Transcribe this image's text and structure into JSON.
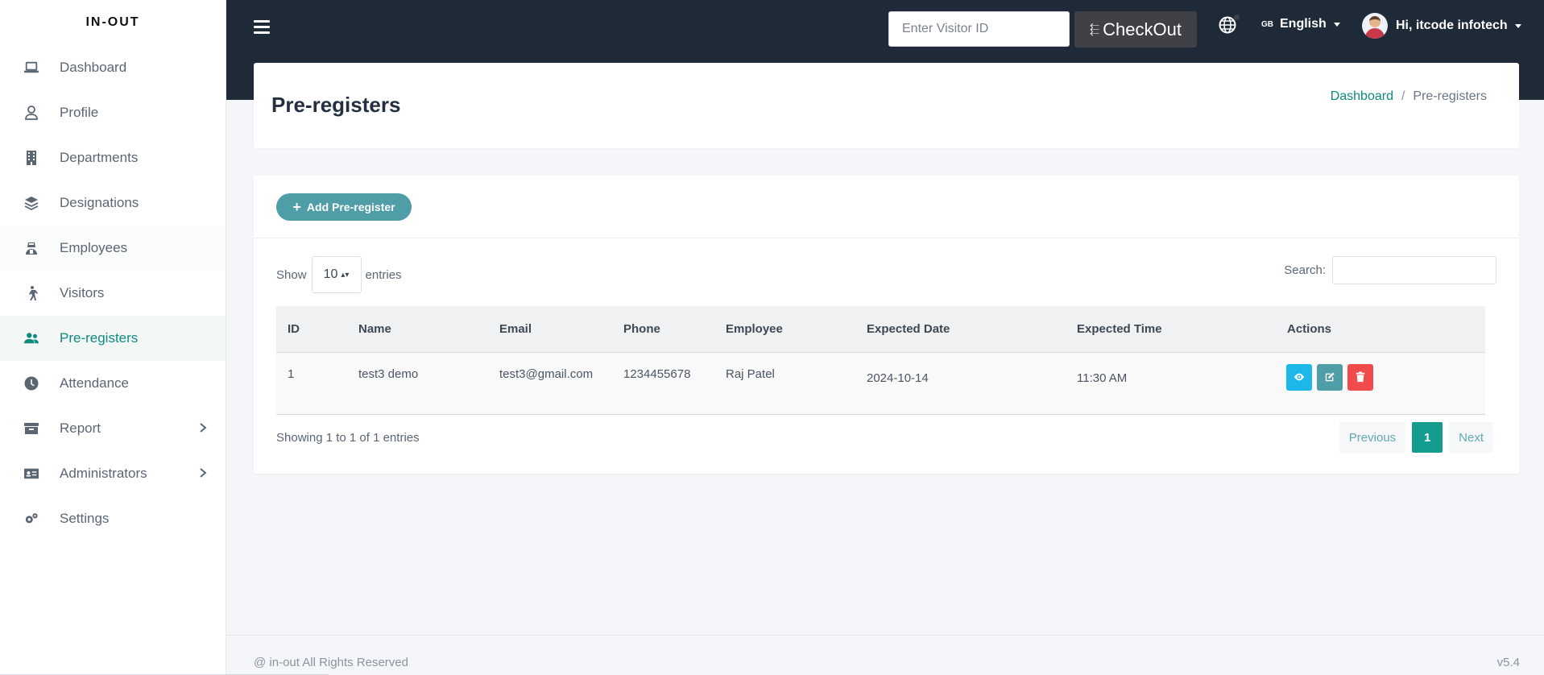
{
  "brand": "IN-OUT",
  "sidebar": {
    "items": [
      {
        "label": "Dashboard",
        "icon": "laptop-icon"
      },
      {
        "label": "Profile",
        "icon": "user-icon"
      },
      {
        "label": "Departments",
        "icon": "building-icon"
      },
      {
        "label": "Designations",
        "icon": "layers-icon"
      },
      {
        "label": "Employees",
        "icon": "user-tie-icon"
      },
      {
        "label": "Visitors",
        "icon": "walking-icon"
      },
      {
        "label": "Pre-registers",
        "icon": "users-icon",
        "active": true
      },
      {
        "label": "Attendance",
        "icon": "clock-icon"
      },
      {
        "label": "Report",
        "icon": "archive-icon",
        "has_submenu": true
      },
      {
        "label": "Administrators",
        "icon": "id-card-icon",
        "has_submenu": true
      },
      {
        "label": "Settings",
        "icon": "cogs-icon"
      }
    ]
  },
  "topbar": {
    "visitor_placeholder": "Enter Visitor ID",
    "checkout_label": "CheckOut",
    "language_flag": "GB",
    "language": "English",
    "user_greeting": "Hi, itcode infotech"
  },
  "header": {
    "title": "Pre-registers",
    "breadcrumb": {
      "home": "Dashboard",
      "separator": "/",
      "current": "Pre-registers"
    }
  },
  "main": {
    "add_button_label": "Add Pre-register",
    "length": {
      "show": "Show",
      "value": "10",
      "entries": "entries"
    },
    "search_label": "Search:",
    "table": {
      "columns": [
        "ID",
        "Name",
        "Email",
        "Phone",
        "Employee",
        "Expected Date",
        "Expected Time",
        "Actions"
      ],
      "rows": [
        {
          "id": "1",
          "name": "test3 demo",
          "email": "test3@gmail.com",
          "phone": "1234455678",
          "employee": "Raj Patel",
          "expected_date": "2024-10-14",
          "expected_time": "11:30 AM"
        }
      ]
    },
    "info": "Showing 1 to 1 of 1 entries",
    "pagination": {
      "previous": "Previous",
      "current": "1",
      "next": "Next"
    }
  },
  "footer": {
    "copyright": "@ in-out All Rights Reserved",
    "version": "v5.4"
  },
  "colors": {
    "accent": "#0f8a7e",
    "header_bg": "#1e2a38",
    "view": "#1cb8ea",
    "edit": "#4f9da6",
    "delete": "#ef4b4b"
  }
}
